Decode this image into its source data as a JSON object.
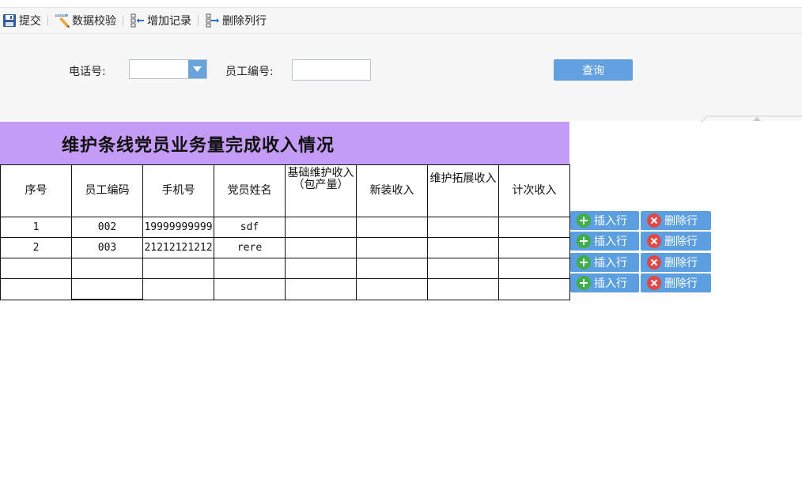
{
  "toolbar": {
    "submit_label": "提交",
    "validate_label": "数据校验",
    "add_record_label": "增加记录",
    "delete_column_label": "删除列行"
  },
  "search": {
    "phone_label": "电话号:",
    "phone_value": "",
    "employee_label": "员工编号:",
    "employee_value": "",
    "query_label": "查询"
  },
  "sheet": {
    "title": "维护条线党员业务量完成收入情况",
    "headers": [
      "序号",
      "员工编码",
      "手机号",
      "党员姓名",
      "基础维护收入（包产量）",
      "新装收入",
      "维护拓展收入",
      "计次收入"
    ],
    "rows": [
      [
        "1",
        "002",
        "19999999999",
        "sdf",
        "",
        "",
        "",
        ""
      ],
      [
        "2",
        "003",
        "21212121212",
        "rere",
        "",
        "",
        "",
        ""
      ],
      [
        "",
        "",
        "",
        "",
        "",
        "",
        "",
        ""
      ],
      [
        "",
        "",
        "",
        "",
        "",
        "",
        "",
        ""
      ]
    ],
    "insert_label": "插入行",
    "delete_label": "删除行"
  },
  "colors": {
    "title_band": "#c49cf6",
    "button_blue": "#5b9fe0",
    "insert_icon": "#3fae49",
    "delete_icon": "#e04848"
  },
  "icons": {
    "submit": "save-icon",
    "validate": "pencil-ruler-icon",
    "add_record": "add-column-icon",
    "delete_column": "delete-column-icon",
    "insert": "plus-icon",
    "delete": "close-icon"
  }
}
